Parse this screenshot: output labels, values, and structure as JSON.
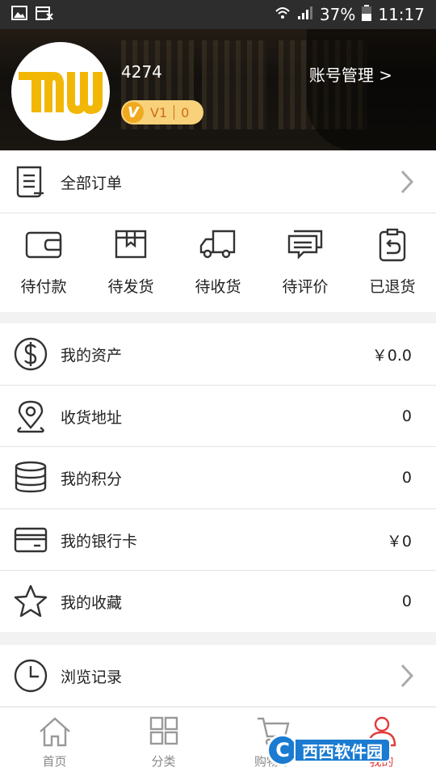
{
  "status_bar": {
    "battery": "37%",
    "time": "11:17"
  },
  "profile": {
    "username": "4274",
    "account_link": "账号管理 >",
    "vip_level": "V1",
    "vip_points": "0"
  },
  "all_orders": {
    "label": "全部订单"
  },
  "order_states": [
    {
      "label": "待付款",
      "icon": "wallet-icon"
    },
    {
      "label": "待发货",
      "icon": "package-icon"
    },
    {
      "label": "待收货",
      "icon": "truck-icon"
    },
    {
      "label": "待评价",
      "icon": "comment-icon"
    },
    {
      "label": "已退货",
      "icon": "return-icon"
    }
  ],
  "menu": [
    {
      "label": "我的资产",
      "value": "￥0.0",
      "icon": "dollar-icon"
    },
    {
      "label": "收货地址",
      "value": "0",
      "icon": "location-pin-icon"
    },
    {
      "label": "我的积分",
      "value": "0",
      "icon": "coins-stack-icon"
    },
    {
      "label": "我的银行卡",
      "value": "￥0",
      "icon": "bank-card-icon"
    },
    {
      "label": "我的收藏",
      "value": "0",
      "icon": "star-icon"
    }
  ],
  "history": {
    "label": "浏览记录"
  },
  "tabs": [
    {
      "label": "首页",
      "icon": "home-icon"
    },
    {
      "label": "分类",
      "icon": "grid-icon"
    },
    {
      "label": "购物车",
      "icon": "cart-icon"
    },
    {
      "label": "我的",
      "icon": "person-icon"
    }
  ],
  "watermark": {
    "circle": "C",
    "text": "西西软件园"
  },
  "colors": {
    "accent": "#e23b3b",
    "logo": "#f2b705",
    "vip_bg": "#f7d27a"
  }
}
